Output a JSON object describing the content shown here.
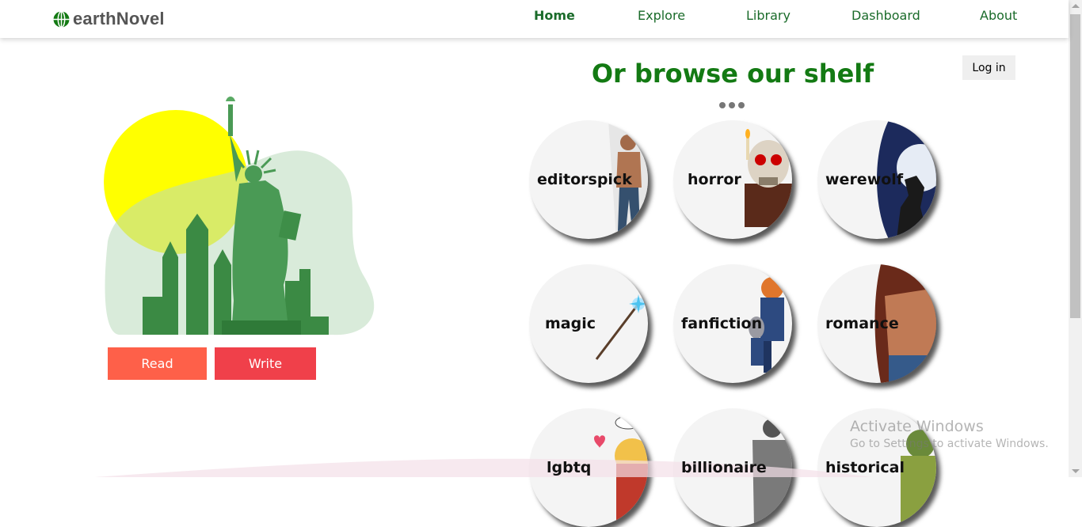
{
  "header": {
    "brand": "earthNovel",
    "brand_icon": "globe-icon",
    "nav": [
      {
        "label": "Home",
        "active": true
      },
      {
        "label": "Explore"
      },
      {
        "label": "Library"
      },
      {
        "label": "Dashboard"
      },
      {
        "label": "About"
      }
    ]
  },
  "hero": {
    "illustration": "statue-of-liberty-skyline",
    "read_label": "Read",
    "write_label": "Write"
  },
  "shelf": {
    "title": "Or browse our shelf",
    "login_label": "Log in",
    "genres": [
      {
        "label": "editorspick",
        "icon": "muscular-man-icon"
      },
      {
        "label": "horror",
        "icon": "skull-icon"
      },
      {
        "label": "werewolf",
        "icon": "werewolf-icon"
      },
      {
        "label": "magic",
        "icon": "magic-wand-icon"
      },
      {
        "label": "fanfiction",
        "icon": "cartoon-characters-icon"
      },
      {
        "label": "romance",
        "icon": "couple-icon"
      },
      {
        "label": "lgbtq",
        "icon": "anime-hearts-icon"
      },
      {
        "label": "billionaire",
        "icon": "shirtless-man-icon"
      },
      {
        "label": "historical",
        "icon": "historical-woman-icon"
      }
    ]
  },
  "watermark": {
    "line1": "Activate Windows",
    "line2": "Go to Settings to activate Windows."
  },
  "colors": {
    "brand_green": "#137a13",
    "nav_green": "#1a6b2a",
    "read_button": "#fe6049",
    "write_button": "#f0404a"
  }
}
